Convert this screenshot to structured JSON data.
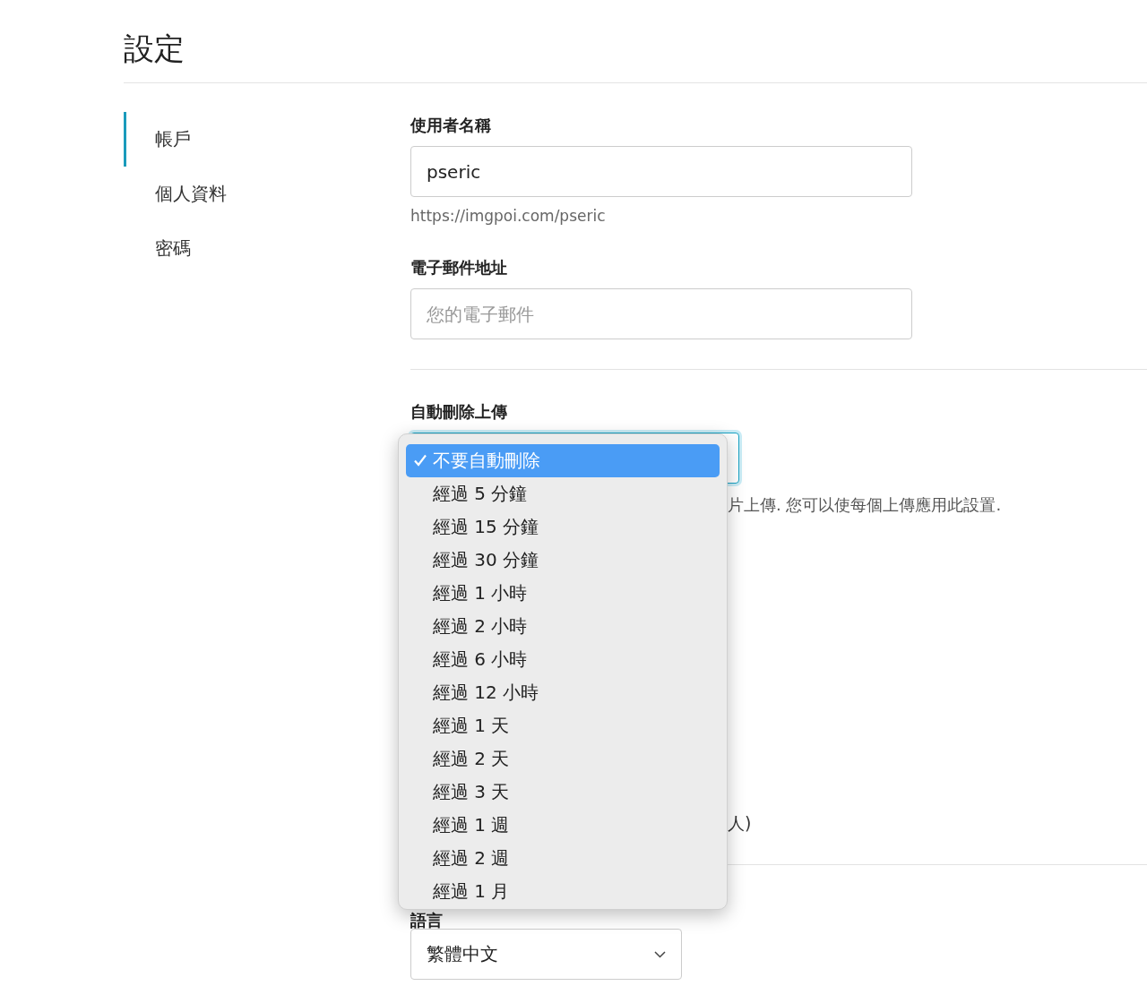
{
  "title": "設定",
  "sidebar": {
    "items": [
      {
        "label": "帳戶",
        "selected": true
      },
      {
        "label": "個人資料",
        "selected": false
      },
      {
        "label": "密碼",
        "selected": false
      }
    ]
  },
  "username": {
    "label": "使用者名稱",
    "value": "pseric",
    "hint": "https://imgpoi.com/pseric"
  },
  "email": {
    "label": "電子郵件地址",
    "placeholder": "您的電子郵件"
  },
  "auto_delete": {
    "label": "自動刪除上傳",
    "focused": true,
    "expanded": true,
    "hint": "片上傳. 您可以使每個上傳應用此設置.",
    "options": [
      {
        "label": "不要自動刪除",
        "selected": true
      },
      {
        "label": "經過 5 分鐘",
        "selected": false
      },
      {
        "label": "經過 15 分鐘",
        "selected": false
      },
      {
        "label": "經過 30 分鐘",
        "selected": false
      },
      {
        "label": "經過 1 小時",
        "selected": false
      },
      {
        "label": "經過 2 小時",
        "selected": false
      },
      {
        "label": "經過 6 小時",
        "selected": false
      },
      {
        "label": "經過 12 小時",
        "selected": false
      },
      {
        "label": "經過 1 天",
        "selected": false
      },
      {
        "label": "經過 2 天",
        "selected": false
      },
      {
        "label": "經過 3 天",
        "selected": false
      },
      {
        "label": "經過 1 週",
        "selected": false
      },
      {
        "label": "經過 2 週",
        "selected": false
      },
      {
        "label": "經過 1 月",
        "selected": false
      }
    ]
  },
  "privacy_fragment": "人)",
  "language": {
    "label": "語言",
    "value": "繁體中文"
  }
}
